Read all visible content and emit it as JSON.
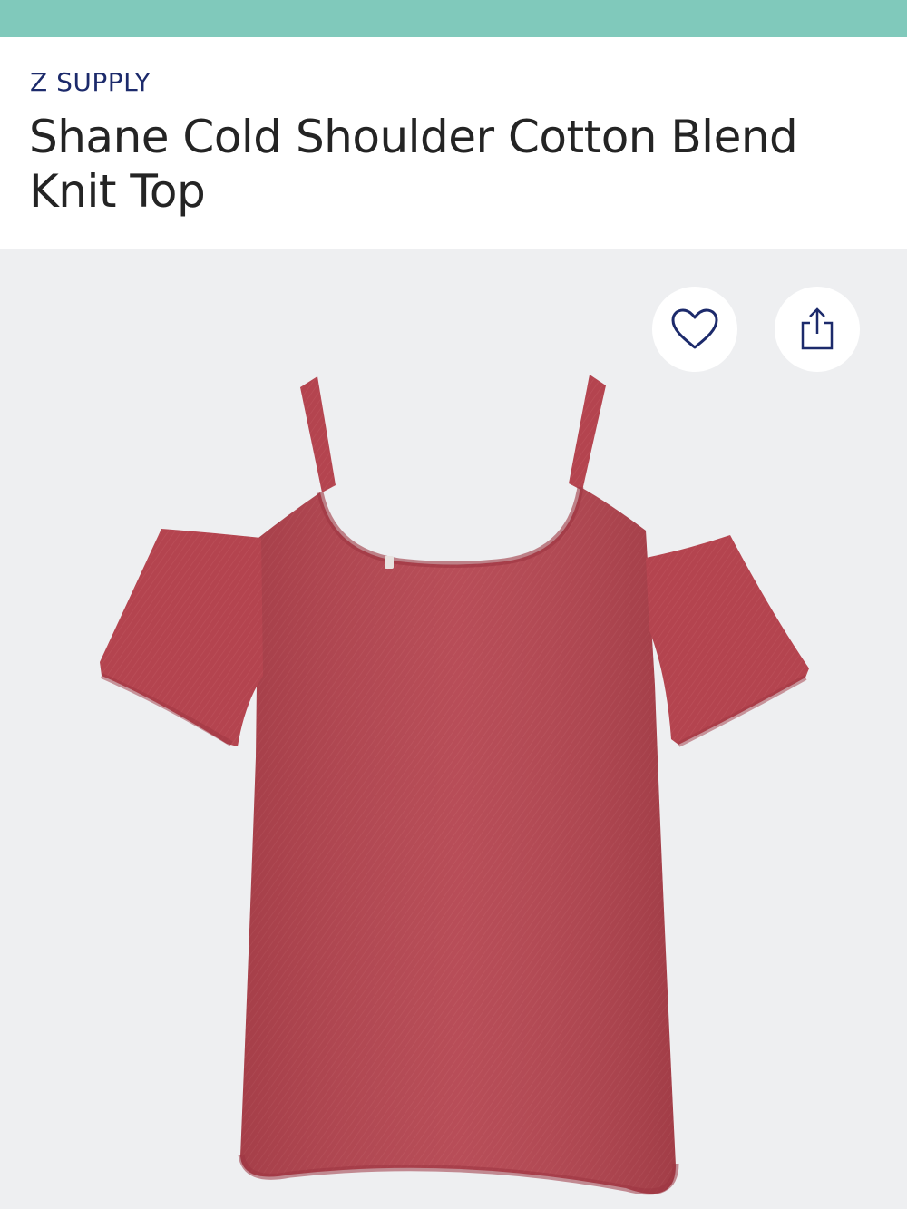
{
  "product": {
    "brand": "Z SUPPLY",
    "title": "Shane Cold Shoulder Cotton Blend Knit Top",
    "color_hex": "#b4444f"
  },
  "actions": {
    "favorite_icon": "heart-outline-icon",
    "share_icon": "share-upload-icon"
  },
  "theme": {
    "top_bar_color": "#80c9bb",
    "brand_color": "#1c2a6b",
    "gallery_background": "#eeeff1"
  }
}
